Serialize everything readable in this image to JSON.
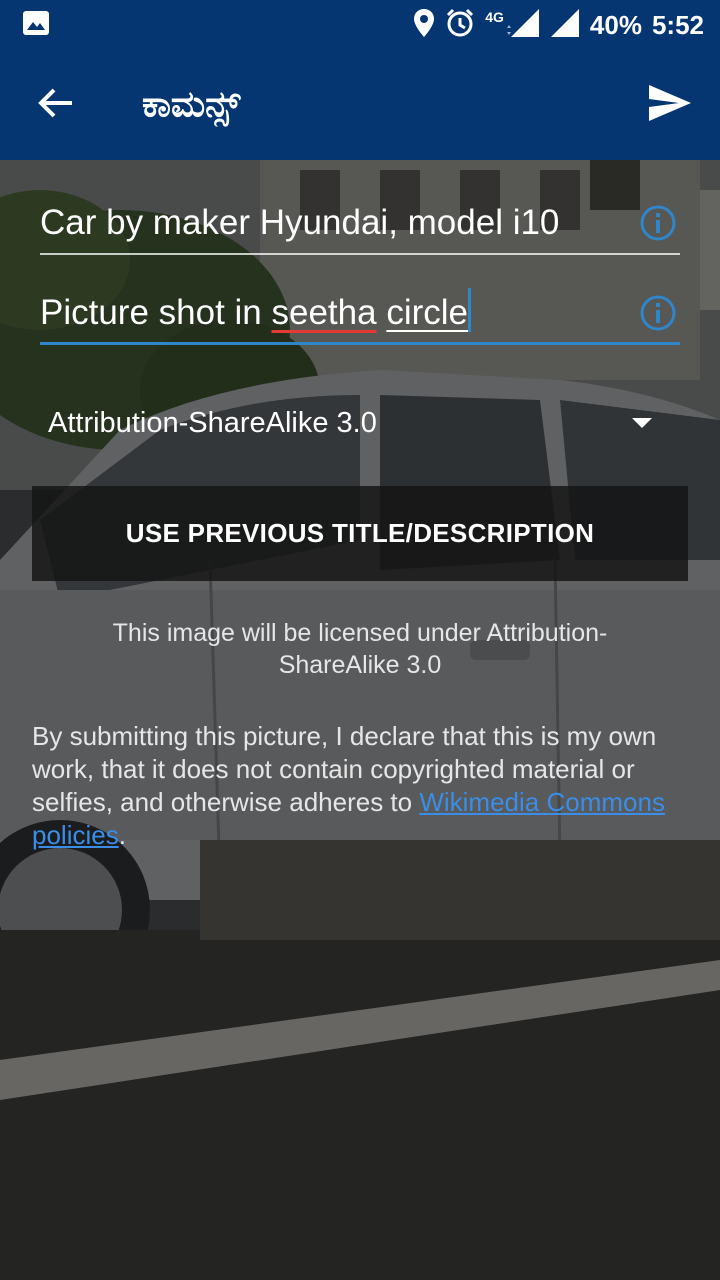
{
  "status_bar": {
    "network": "4G",
    "battery": "40%",
    "time": "5:52",
    "icons": [
      "image-icon",
      "location-icon",
      "alarm-icon",
      "signal-icon",
      "cell-signal-icon"
    ]
  },
  "toolbar": {
    "title": "ಕಾಮನ್ಸ್",
    "back_icon": "arrow-left-icon",
    "send_icon": "send-icon"
  },
  "form": {
    "title_value": "Car by maker Hyundai, model i10",
    "description": {
      "prefix": "Picture shot in ",
      "word1": "seetha",
      "space": " ",
      "word2": "circle"
    },
    "license": "Attribution-ShareAlike 3.0",
    "previous_button": "USE PREVIOUS TITLE/DESCRIPTION",
    "license_note": "This image will be licensed under Attribution-ShareAlike 3.0",
    "declaration_text": "By submitting this picture, I declare that this is my own work, that it does not contain copyrighted material or selfies, and otherwise adheres to ",
    "policy_link": "Wikimedia Commons policies",
    "declaration_end": "."
  },
  "colors": {
    "primary": "#053672",
    "accent": "#2f86c8",
    "link": "#3a8ee8",
    "spellcheck": "#e53935"
  }
}
